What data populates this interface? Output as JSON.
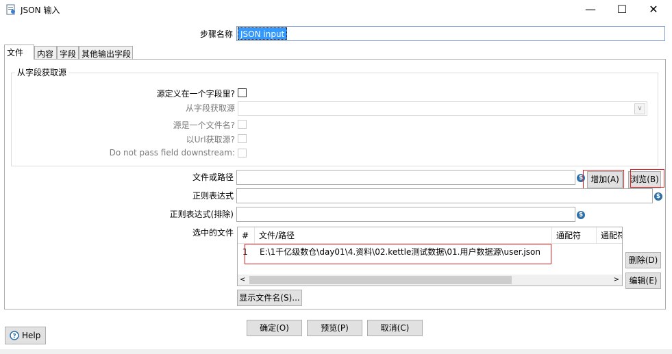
{
  "window": {
    "title": "JSON 输入",
    "minimize": "—",
    "maximize": "☐",
    "close": "✕"
  },
  "step_name": {
    "label": "步骤名称",
    "value": "JSON input"
  },
  "tabs": [
    {
      "label": "文件",
      "active": true
    },
    {
      "label": "内容",
      "active": false
    },
    {
      "label": "字段",
      "active": false
    },
    {
      "label": "其他输出字段",
      "active": false
    }
  ],
  "source_group": {
    "title": "从字段获取源",
    "source_in_field_label": "源定义在一个字段里?",
    "get_source_from_field_label": "从字段获取源",
    "source_is_filename_label": "源是一个文件名?",
    "read_url_label": "以Url获取源?",
    "do_not_pass_label": "Do not pass field downstream:"
  },
  "file": {
    "path_label": "文件或路径",
    "path_value": "",
    "add_button": "增加(A)",
    "browse_button": "浏览(B)",
    "regex_label": "正则表达式",
    "regex_value": "",
    "regex_exclude_label": "正则表达式(排除)",
    "regex_exclude_value": ""
  },
  "selected_files": {
    "label": "选中的文件",
    "columns": [
      "#",
      "文件/路径",
      "通配符",
      "通配符"
    ],
    "rows": [
      {
        "num": "1",
        "path": "E:\\1千亿级数仓\\day01\\4.资料\\02.kettle测试数据\\01.用户数据源\\user.json"
      }
    ],
    "delete_button": "删除(D)",
    "edit_button": "编辑(E)",
    "show_files_button": "显示文件名(S)..."
  },
  "footer": {
    "ok": "确定(O)",
    "preview": "预览(P)",
    "cancel": "取消(C)",
    "help": "Help"
  },
  "colors": {
    "selection": "#3399ff",
    "highlight_box": "#e02020",
    "variable_icon": "#2f6fa7"
  }
}
